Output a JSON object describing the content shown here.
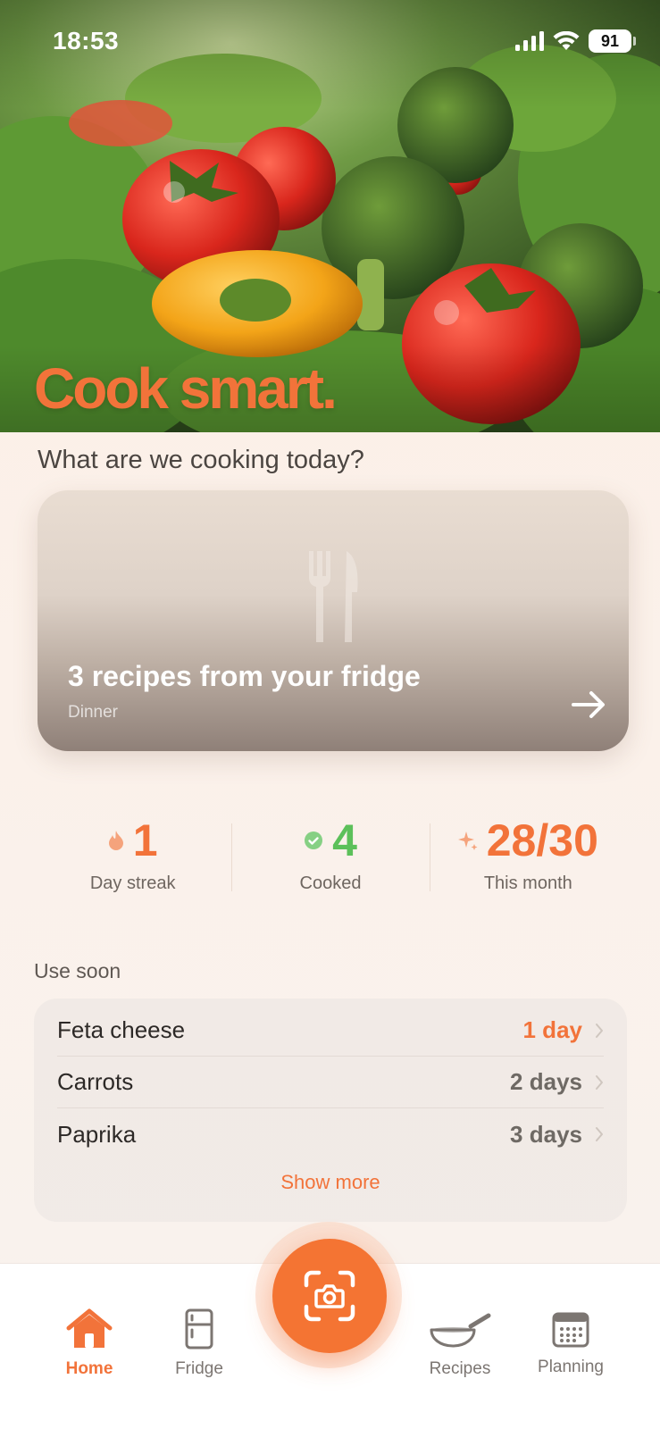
{
  "status_bar": {
    "time": "18:53",
    "battery": "91"
  },
  "hero": {
    "title": "Cook smart."
  },
  "prompt": "What are we cooking today?",
  "recipe_card": {
    "title": "3 recipes from your fridge",
    "subtitle": "Dinner"
  },
  "stats": [
    {
      "value": "1",
      "label": "Day streak",
      "icon": "flame-icon",
      "color": "#f2733a"
    },
    {
      "value": "4",
      "label": "Cooked",
      "icon": "check-circle-icon",
      "color": "#5cc05a"
    },
    {
      "value": "28/30",
      "label": "This month",
      "icon": "sparkle-icon",
      "color": "#f2733a"
    }
  ],
  "use_soon": {
    "title": "Use soon",
    "items": [
      {
        "name": "Feta cheese",
        "days": "1 day",
        "urgent": true
      },
      {
        "name": "Carrots",
        "days": "2 days",
        "urgent": false
      },
      {
        "name": "Paprika",
        "days": "3 days",
        "urgent": false
      }
    ],
    "show_more": "Show more"
  },
  "tabs": {
    "home": "Home",
    "fridge": "Fridge",
    "recipes": "Recipes",
    "planning": "Planning",
    "active": "Home"
  },
  "colors": {
    "accent": "#f2733a",
    "success": "#5cc05a",
    "background": "#fbf0e8"
  }
}
